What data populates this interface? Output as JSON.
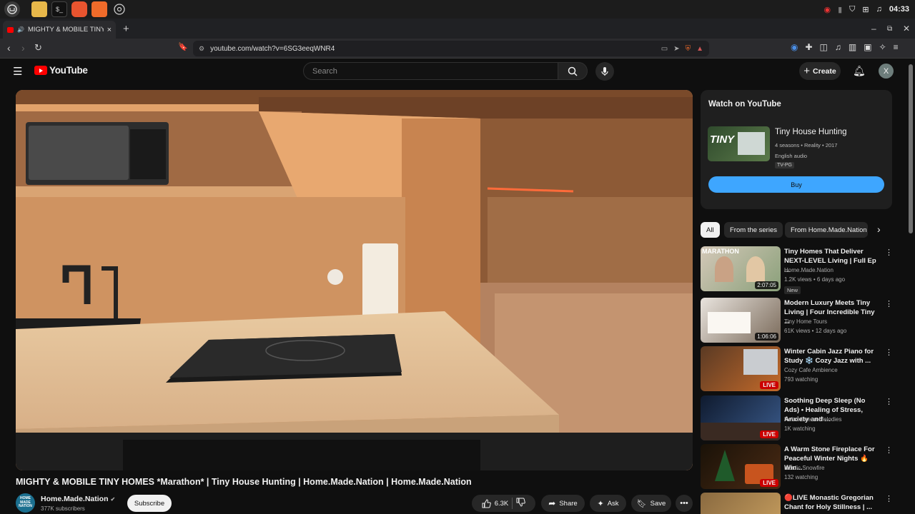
{
  "os": {
    "clock": "04:33"
  },
  "browser": {
    "tab_title": "MIGHTY & MOBILE TINY H",
    "url": "youtube.com/watch?v=6SG3eeqWNR4"
  },
  "youtube": {
    "logo_text": "YouTube",
    "search_placeholder": "Search",
    "create_label": "Create",
    "avatar_letter": "X"
  },
  "video": {
    "title": "MIGHTY & MOBILE TINY HOMES *Marathon* | Tiny House Hunting | Home.Made.Nation | Home.Made.Nation",
    "channel_name": "Home.Made.Nation",
    "channel_avatar_text": "HOME MADE NATION",
    "subscribers": "377K subscribers",
    "subscribe_label": "Subscribe",
    "likes": "6.3K",
    "share_label": "Share",
    "ask_label": "Ask",
    "save_label": "Save"
  },
  "watch_card": {
    "heading": "Watch on YouTube",
    "show_title": "Tiny House Hunting",
    "thumb_text": "TINY",
    "meta": "4 seasons • Reality • 2017",
    "audio": "English audio",
    "rating": "TV-PG",
    "buy_label": "Buy"
  },
  "chips": [
    "All",
    "From the series",
    "From Home.Made.Nation"
  ],
  "recommendations": [
    {
      "title": "Tiny Homes That Deliver NEXT-LEVEL Living | Full Ep ...",
      "channel": "Home.Made.Nation",
      "meta": "1.2K views • 6 days ago",
      "badge": "New",
      "duration": "2:07:05",
      "thumb_overlay": "MARATHON"
    },
    {
      "title": "Modern Luxury Meets Tiny Living | Four Incredible Tiny ...",
      "channel": "Tiny Home Tours",
      "meta": "61K views • 12 days ago",
      "duration": "1:06:06"
    },
    {
      "title": "Winter Cabin Jazz Piano for Study ❄️ Cozy Jazz with ...",
      "channel": "Cozy Cafe Ambience",
      "meta": "793 watching",
      "live": "LIVE"
    },
    {
      "title": "Soothing Deep Sleep (No Ads) • Healing of Stress, Anxiety and ...",
      "channel": "Relax Ocean Melodies",
      "meta": "1K watching",
      "live": "LIVE"
    },
    {
      "title": "A Warm Stone Fireplace For Peaceful Winter Nights 🔥Win...",
      "channel": "Nordic Snowfire",
      "meta": "132 watching",
      "live": "LIVE"
    },
    {
      "title": "🔴LIVE Monastic Gregorian Chant for Holy Stillness | ..."
    }
  ]
}
